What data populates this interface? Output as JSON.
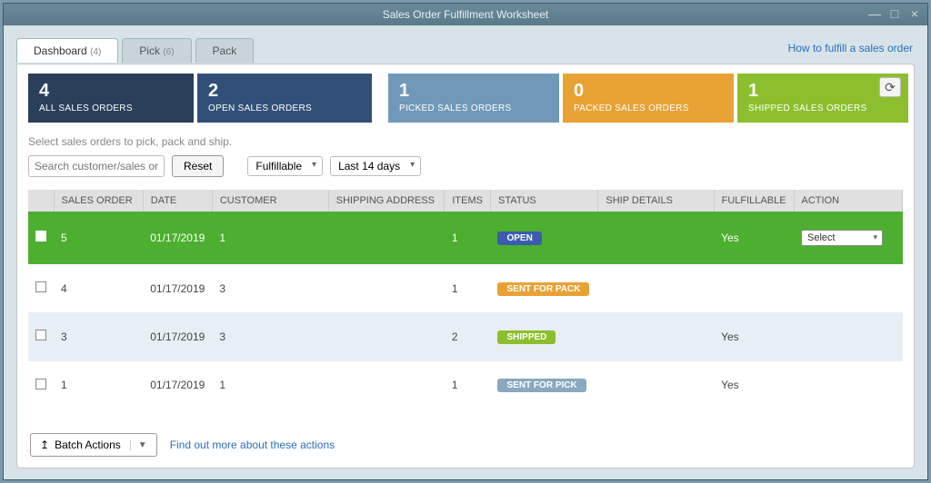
{
  "window": {
    "title": "Sales Order Fulfillment Worksheet"
  },
  "tabs": [
    {
      "label": "Dashboard",
      "count": "(4)"
    },
    {
      "label": "Pick",
      "count": "(6)"
    },
    {
      "label": "Pack",
      "count": ""
    }
  ],
  "help_link": "How to fulfill a sales order",
  "cards": [
    {
      "num": "4",
      "label": "ALL SALES ORDERS"
    },
    {
      "num": "2",
      "label": "OPEN SALES ORDERS"
    },
    {
      "num": "1",
      "label": "PICKED SALES ORDERS"
    },
    {
      "num": "0",
      "label": "PACKED SALES ORDERS"
    },
    {
      "num": "1",
      "label": "SHIPPED SALES ORDERS"
    }
  ],
  "instruction": "Select sales orders to pick, pack and ship.",
  "filters": {
    "search_placeholder": "Search customer/sales order",
    "reset": "Reset",
    "status": "Fulfillable",
    "range": "Last 14 days"
  },
  "columns": [
    "",
    "SALES ORDER",
    "DATE",
    "CUSTOMER",
    "SHIPPING ADDRESS",
    "ITEMS",
    "STATUS",
    "SHIP DETAILS",
    "FULFILLABLE",
    "ACTION"
  ],
  "rows": [
    {
      "selected": true,
      "so": "5",
      "date": "01/17/2019",
      "cust": "1",
      "addr": "",
      "items": "1",
      "status": "OPEN",
      "badge": "open",
      "ship": "",
      "fulfill": "Yes",
      "action": "Select"
    },
    {
      "selected": false,
      "so": "4",
      "date": "01/17/2019",
      "cust": "3",
      "addr": "",
      "items": "1",
      "status": "SENT FOR PACK",
      "badge": "pack",
      "ship": "",
      "fulfill": "",
      "action": ""
    },
    {
      "selected": false,
      "so": "3",
      "date": "01/17/2019",
      "cust": "3",
      "addr": "",
      "items": "2",
      "status": "SHIPPED",
      "badge": "shipped",
      "ship": "",
      "fulfill": "Yes",
      "action": ""
    },
    {
      "selected": false,
      "so": "1",
      "date": "01/17/2019",
      "cust": "1",
      "addr": "",
      "items": "1",
      "status": "SENT FOR PICK",
      "badge": "pick",
      "ship": "",
      "fulfill": "Yes",
      "action": ""
    }
  ],
  "footer": {
    "batch": "Batch Actions",
    "link": "Find out more about these actions"
  }
}
